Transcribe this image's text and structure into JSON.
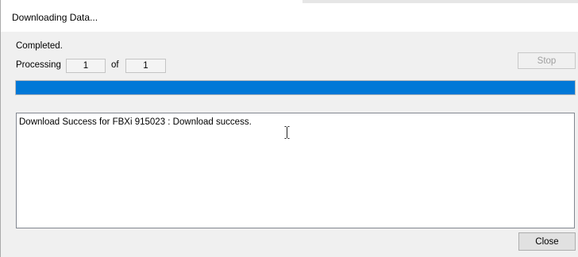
{
  "window": {
    "title": "Downloading Data..."
  },
  "status": {
    "text": "Completed."
  },
  "processing": {
    "label": "Processing",
    "current": "1",
    "of_label": "of",
    "total": "1"
  },
  "buttons": {
    "stop_label": "Stop",
    "close_label": "Close"
  },
  "progress": {
    "fraction": 1.0,
    "color": "#0078d7"
  },
  "log": {
    "lines": [
      "Download Success for FBXi 915023 : Download success."
    ]
  },
  "icons": {
    "cursor": "ibeam-cursor-icon"
  }
}
